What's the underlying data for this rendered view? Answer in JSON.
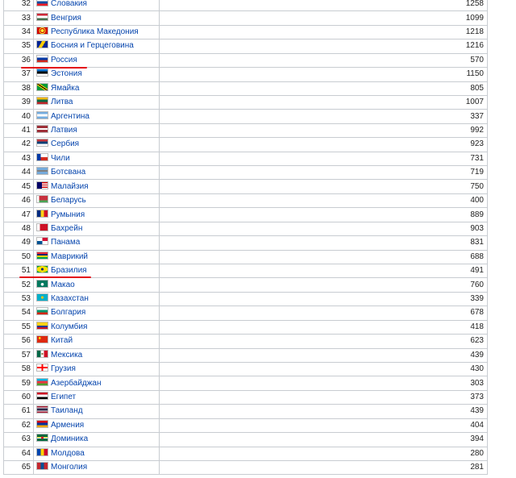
{
  "table": {
    "rows": [
      {
        "rank": "32",
        "country": "Словакия",
        "value": "1258",
        "flag": "flag-slovakia",
        "flag_css": "linear-gradient(#ffffff 0 33%, #0b4ea2 33% 66%, #ee1c25 66%)"
      },
      {
        "rank": "33",
        "country": "Венгрия",
        "value": "1099",
        "flag": "flag-hungary",
        "flag_css": "linear-gradient(#ce2939 0 33%, #ffffff 33% 66%, #477050 66%)"
      },
      {
        "rank": "34",
        "country": "Республика Македония",
        "value": "1218",
        "flag": "flag-macedonia",
        "flag_css": "radial-gradient(circle, #f8e92e 0 25%, #d20000 26% 40%, #f8e92e 41% 52%, #d20000 53%)"
      },
      {
        "rank": "35",
        "country": "Босния и Герцеговина",
        "value": "1216",
        "flag": "flag-bosnia",
        "flag_css": "linear-gradient(120deg, #002395 0 35%, #fecb00 35% 60%, #002395 60%)"
      },
      {
        "rank": "36",
        "country": "Россия",
        "value": "570",
        "flag": "flag-russia",
        "flag_css": "linear-gradient(#ffffff 0 33%, #0039a6 33% 66%, #d52b1e 66%)"
      },
      {
        "rank": "37",
        "country": "Эстония",
        "value": "1150",
        "flag": "flag-estonia",
        "flag_css": "linear-gradient(#0072ce 0 33%, #000000 33% 66%, #ffffff 66%)"
      },
      {
        "rank": "38",
        "country": "Ямайка",
        "value": "805",
        "flag": "flag-jamaica",
        "flag_css": "linear-gradient(33deg, #009b3a 0 38%, #fed100 38% 46%, #000000 46% 54%, #fed100 54% 62%, #009b3a 62%)"
      },
      {
        "rank": "39",
        "country": "Литва",
        "value": "1007",
        "flag": "flag-lithuania",
        "flag_css": "linear-gradient(#fdb913 0 33%, #006a44 33% 66%, #c1272d 66%)"
      },
      {
        "rank": "40",
        "country": "Аргентина",
        "value": "337",
        "flag": "flag-argentina",
        "flag_css": "linear-gradient(#74acdf 0 33%, #ffffff 33% 66%, #74acdf 66%)"
      },
      {
        "rank": "41",
        "country": "Латвия",
        "value": "992",
        "flag": "flag-latvia",
        "flag_css": "linear-gradient(#9e3039 0 40%, #ffffff 40% 60%, #9e3039 60%)"
      },
      {
        "rank": "42",
        "country": "Сербия",
        "value": "923",
        "flag": "flag-serbia",
        "flag_css": "linear-gradient(#c6363c 0 33%, #0c4076 33% 66%, #ffffff 66%)"
      },
      {
        "rank": "43",
        "country": "Чили",
        "value": "731",
        "flag": "flag-chile",
        "flag_css": "linear-gradient(90deg, #0039a6 0 35%, transparent 35%), linear-gradient(#ffffff 0 50%, #d52b1e 50%)"
      },
      {
        "rank": "44",
        "country": "Ботсвана",
        "value": "719",
        "flag": "flag-botswana",
        "flag_css": "linear-gradient(#75aadb 0 38%, #ffffff 38% 42%, #000000 42% 58%, #ffffff 58% 62%, #75aadb 62%)"
      },
      {
        "rank": "45",
        "country": "Малайзия",
        "value": "750",
        "flag": "flag-malaysia",
        "flag_css": "linear-gradient(90deg, #010066 0 45%, transparent 45%), repeating-linear-gradient(#cc0001 0 1.4px, #ffffff 1.4px 2.8px)"
      },
      {
        "rank": "46",
        "country": "Беларусь",
        "value": "400",
        "flag": "flag-belarus",
        "flag_css": "linear-gradient(90deg, #ffffff 0 18%, transparent 18%), linear-gradient(#c8313e 0 66%, #4aa657 66%)"
      },
      {
        "rank": "47",
        "country": "Румыния",
        "value": "889",
        "flag": "flag-romania",
        "flag_css": "linear-gradient(90deg, #002b7f 0 33%, #fcd116 33% 66%, #ce1126 66%)"
      },
      {
        "rank": "48",
        "country": "Бахрейн",
        "value": "903",
        "flag": "flag-bahrain",
        "flag_css": "linear-gradient(90deg, #ffffff 0 28%, #ce1126 28%)"
      },
      {
        "rank": "49",
        "country": "Панама",
        "value": "831",
        "flag": "flag-panama",
        "flag_css": "linear-gradient(90deg, #ffffff 0 50%, #d21034 50%) top / 100% 50% no-repeat, linear-gradient(90deg, #005293 0 50%, #ffffff 50%) bottom / 100% 50% no-repeat"
      },
      {
        "rank": "50",
        "country": "Маврикий",
        "value": "688",
        "flag": "flag-mauritius",
        "flag_css": "linear-gradient(#ea2839 0 25%, #1a206d 25% 50%, #ffd500 50% 75%, #00a551 75%)"
      },
      {
        "rank": "51",
        "country": "Бразилия",
        "value": "491",
        "flag": "flag-brazil",
        "flag_css": "radial-gradient(circle, #002776 0 22%, transparent 23%), radial-gradient(ellipse 55% 48%, #fedf00 0 99%, transparent 100%), #009c3b"
      },
      {
        "rank": "52",
        "country": "Макао",
        "value": "760",
        "flag": "flag-macau",
        "flag_css": "radial-gradient(circle at 50% 60%, #ffffff 0 22%, transparent 23%), #00785e"
      },
      {
        "rank": "53",
        "country": "Казахстан",
        "value": "339",
        "flag": "flag-kazakhstan",
        "flag_css": "radial-gradient(circle, #fec50c 0 20%, transparent 21%), #00afca"
      },
      {
        "rank": "54",
        "country": "Болгария",
        "value": "678",
        "flag": "flag-bulgaria",
        "flag_css": "linear-gradient(#ffffff 0 33%, #00966e 33% 66%, #d62612 66%)"
      },
      {
        "rank": "55",
        "country": "Колумбия",
        "value": "418",
        "flag": "flag-colombia",
        "flag_css": "linear-gradient(#fcd116 0 50%, #003893 50% 75%, #ce1126 75%)"
      },
      {
        "rank": "56",
        "country": "Китай",
        "value": "623",
        "flag": "flag-china",
        "flag_css": "radial-gradient(circle at 25% 30%, #ffde00 0 12%, transparent 13%), #de2910"
      },
      {
        "rank": "57",
        "country": "Мексика",
        "value": "439",
        "flag": "flag-mexico",
        "flag_css": "radial-gradient(circle, #8c6a3b 0 14%, transparent 15%), linear-gradient(90deg, #006847 0 33%, #ffffff 33% 66%, #ce1126 66%)"
      },
      {
        "rank": "58",
        "country": "Грузия",
        "value": "430",
        "flag": "flag-georgia",
        "flag_css": "linear-gradient(90deg, transparent 0 43%, #ff0000 43% 57%, transparent 57%), linear-gradient(transparent 0 40%, #ff0000 40% 60%, transparent 60%), #ffffff"
      },
      {
        "rank": "59",
        "country": "Азербайджан",
        "value": "303",
        "flag": "flag-azerbaijan",
        "flag_css": "linear-gradient(#00b5e2 0 33%, #ef3340 33% 66%, #509e2f 66%)"
      },
      {
        "rank": "60",
        "country": "Египет",
        "value": "373",
        "flag": "flag-egypt",
        "flag_css": "linear-gradient(#ce1126 0 33%, #ffffff 33% 66%, #000000 66%)"
      },
      {
        "rank": "61",
        "country": "Таиланд",
        "value": "439",
        "flag": "flag-thailand",
        "flag_css": "linear-gradient(#a51931 0 16%, #f4f5f8 16% 33%, #2d2a4a 33% 66%, #f4f5f8 66% 83%, #a51931 83%)"
      },
      {
        "rank": "62",
        "country": "Армения",
        "value": "404",
        "flag": "flag-armenia",
        "flag_css": "linear-gradient(#d90012 0 33%, #0033a0 33% 66%, #f2a800 66%)"
      },
      {
        "rank": "63",
        "country": "Доминика",
        "value": "394",
        "flag": "flag-dominica",
        "flag_css": "radial-gradient(circle, #d41c30 0 22%, transparent 23%), linear-gradient(transparent 0 40%, #fcd116 40% 47%, #000000 47% 53%, #ffffff 53% 60%, transparent 60%), #006b3f"
      },
      {
        "rank": "64",
        "country": "Молдова",
        "value": "280",
        "flag": "flag-moldova",
        "flag_css": "linear-gradient(90deg, #0046ae 0 33%, #ffd200 33% 66%, #cc092f 66%)"
      },
      {
        "rank": "65",
        "country": "Монголия",
        "value": "281",
        "flag": "flag-mongolia",
        "flag_css": "linear-gradient(90deg, #c4272f 0 33%, #015197 33% 66%, #c4272f 66%)"
      }
    ]
  },
  "highlights": {
    "color": "#e30613",
    "rows": [
      "36",
      "51"
    ]
  }
}
